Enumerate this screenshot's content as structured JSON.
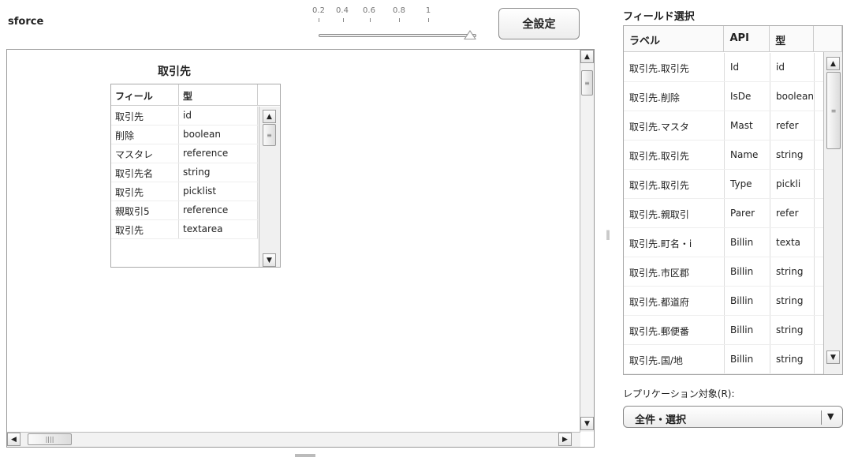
{
  "app": {
    "title": "sforce"
  },
  "zoom": {
    "ticks": [
      "0.2",
      "0.4",
      "0.6",
      "0.8",
      "1"
    ],
    "value": 1
  },
  "toolbar": {
    "select_all_label": "全設定"
  },
  "entity": {
    "title": "取引先",
    "columns": [
      "フィール",
      "型"
    ],
    "rows": [
      {
        "field": "取引先",
        "type": "id"
      },
      {
        "field": "削除",
        "type": "boolean"
      },
      {
        "field": "マスタレ",
        "type": "reference"
      },
      {
        "field": "取引先名",
        "type": "string"
      },
      {
        "field": "取引先",
        "type": "picklist"
      },
      {
        "field": "親取引5",
        "type": "reference"
      },
      {
        "field": "取引先",
        "type": "textarea"
      }
    ]
  },
  "field_panel": {
    "title": "フィールド選択",
    "columns": [
      "ラベル",
      "API",
      "型",
      ""
    ],
    "rows": [
      {
        "label": "取引先.取引先",
        "api": "Id",
        "type": "id"
      },
      {
        "label": "取引先.削除",
        "api": "IsDe",
        "type": "boolean"
      },
      {
        "label": "取引先.マスタ",
        "api": "Mast",
        "type": "refer"
      },
      {
        "label": "取引先.取引先",
        "api": "Name",
        "type": "string"
      },
      {
        "label": "取引先.取引先",
        "api": "Type",
        "type": "pickli"
      },
      {
        "label": "取引先.親取引",
        "api": "Parer",
        "type": "refer"
      },
      {
        "label": "取引先.町名・i",
        "api": "Billin",
        "type": "texta"
      },
      {
        "label": "取引先.市区郡",
        "api": "Billin",
        "type": "string"
      },
      {
        "label": "取引先.都道府",
        "api": "Billin",
        "type": "string"
      },
      {
        "label": "取引先.郵便番",
        "api": "Billin",
        "type": "string"
      },
      {
        "label": "取引先.国/地",
        "api": "Billin",
        "type": "string"
      }
    ]
  },
  "replication": {
    "label": "レプリケーション対象(R):",
    "selected": "全件・選択"
  },
  "icons": {
    "up": "up-arrow-icon",
    "down": "down-arrow-icon",
    "left": "left-arrow-icon",
    "right": "right-arrow-icon",
    "grip": "grip-icon",
    "dropdown": "dropdown-icon"
  }
}
